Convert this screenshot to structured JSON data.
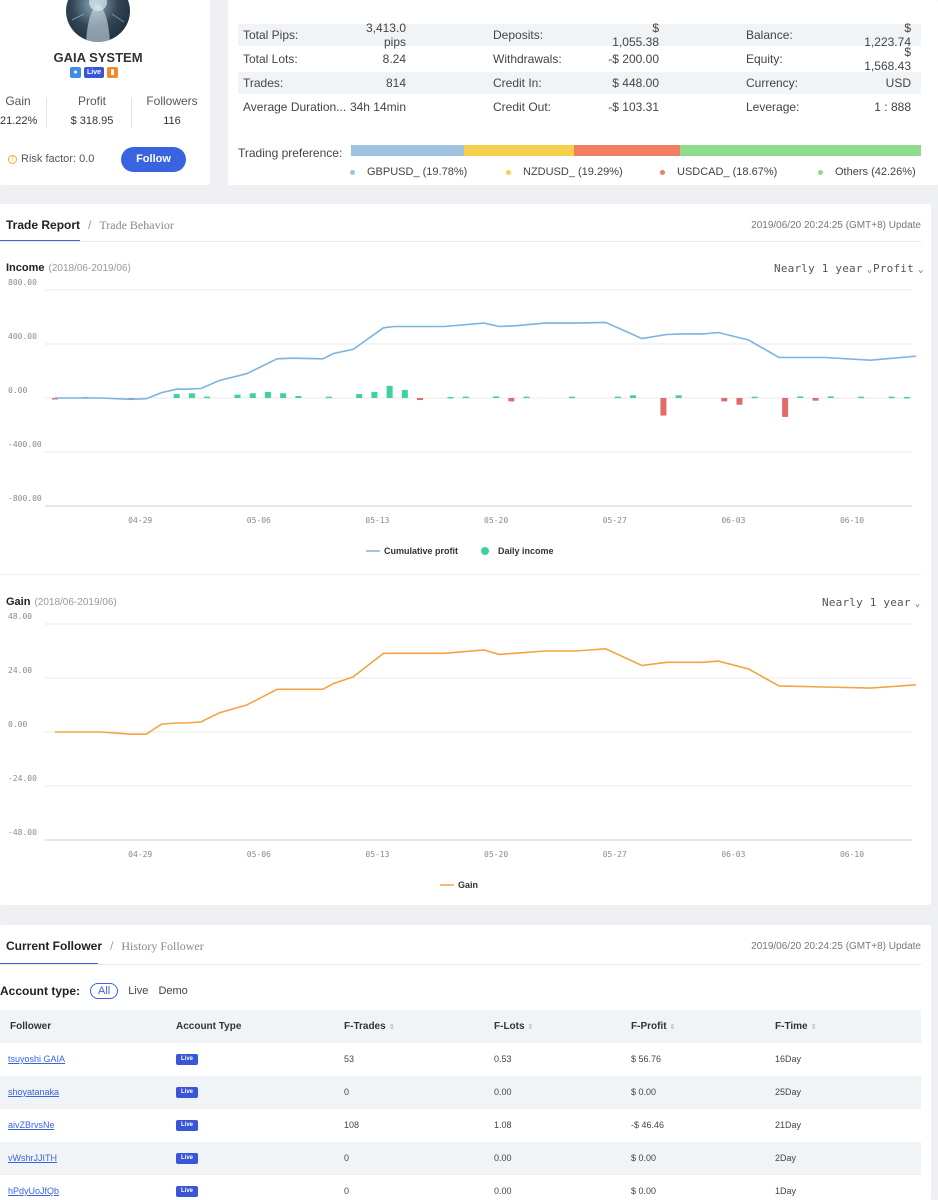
{
  "profile": {
    "name": "GAIA SYSTEM",
    "live_badge": "Live",
    "gain_label": "Gain",
    "gain_value": "21.22%",
    "profit_label": "Profit",
    "profit_value": "$ 318.95",
    "followers_label": "Followers",
    "followers_value": "116",
    "risk_text": "Risk factor: 0.0",
    "follow_button": "Follow"
  },
  "stats": {
    "rows": [
      [
        "Total Pips:",
        "3,413.0 pips",
        "Deposits:",
        "$ 1,055.38",
        "Balance:",
        "$ 1,223.74"
      ],
      [
        "Total Lots:",
        "8.24",
        "Withdrawals:",
        "-$ 200.00",
        "Equity:",
        "$ 1,568.43"
      ],
      [
        "Trades:",
        "814",
        "Credit In:",
        "$ 448.00",
        "Currency:",
        "USD"
      ],
      [
        "Average Duration...",
        "34h 14min",
        "Credit Out:",
        "-$ 103.31",
        "Leverage:",
        "1 : 888"
      ]
    ],
    "trading_preference_label": "Trading preference:",
    "preference": [
      {
        "label": "GBPUSD_ (19.78%)",
        "share": 19.78,
        "color": "#9ec3e0"
      },
      {
        "label": "NZDUSD_ (19.29%)",
        "share": 19.29,
        "color": "#f6d04d"
      },
      {
        "label": "USDCAD_ (18.67%)",
        "share": 18.67,
        "color": "#f07e61"
      },
      {
        "label": "Others (42.26%)",
        "share": 42.26,
        "color": "#8fdc8c"
      }
    ]
  },
  "report": {
    "tab_active": "Trade Report",
    "tab_sep": "/",
    "tab_inactive": "Trade Behavior",
    "timestamp": "2019/06/20 20:24:25 (GMT+8) Update",
    "income": {
      "title": "Income",
      "range": "(2018/06-2019/06)",
      "period": "Nearly 1 year",
      "metric": "Profit",
      "legend_line": "Cumulative profit",
      "legend_bar": "Daily income"
    },
    "gain": {
      "title": "Gain",
      "range": "(2018/06-2019/06)",
      "period": "Nearly 1 year",
      "legend_line": "Gain"
    }
  },
  "chart_data": [
    {
      "type": "line",
      "title": "Income",
      "ylim": [
        -800,
        800
      ],
      "yticks": [
        "800.00",
        "400.00",
        "0.00",
        "-400.00",
        "-800.00"
      ],
      "categories": [
        "04-29",
        "05-06",
        "05-13",
        "05-20",
        "05-27",
        "06-03",
        "06-10",
        "06-17"
      ],
      "series": [
        {
          "name": "Cumulative profit",
          "color": "#7cb3e0",
          "x": [
            0,
            3,
            5,
            6,
            7,
            8,
            8.6,
            9.6,
            10.8,
            12.6,
            14.6,
            15.6,
            17.6,
            18.3,
            19.6,
            21.6,
            22.3,
            23.3,
            25.6,
            28.2,
            29.2,
            30.2,
            32.2,
            33.2,
            34.2,
            36.2,
            38.6,
            40.2,
            41.2,
            42.6,
            43.6,
            45.6,
            47.6,
            50.6,
            53.6,
            55.6,
            56.6
          ],
          "values": [
            0,
            0,
            -10,
            -5,
            40,
            65,
            65,
            70,
            130,
            180,
            290,
            295,
            290,
            330,
            360,
            520,
            530,
            530,
            530,
            555,
            530,
            535,
            555,
            555,
            555,
            560,
            440,
            470,
            475,
            475,
            485,
            430,
            300,
            300,
            280,
            300,
            310
          ]
        }
      ],
      "bars": {
        "name": "Daily income",
        "positive_color": "#3dd39a",
        "negative_color": "#e36a6a",
        "x": [
          0,
          2,
          5,
          8,
          9,
          10,
          12,
          13,
          14,
          15,
          16,
          18,
          20,
          21,
          22,
          23,
          24,
          26,
          27,
          29,
          30,
          31,
          34,
          37,
          38,
          40,
          41,
          44,
          45,
          46,
          48,
          49,
          50,
          51,
          53,
          55,
          56
        ],
        "values": [
          -8,
          8,
          -10,
          30,
          35,
          10,
          25,
          35,
          45,
          35,
          15,
          10,
          30,
          45,
          90,
          60,
          -15,
          8,
          10,
          12,
          -25,
          10,
          10,
          10,
          20,
          -130,
          20,
          -25,
          -50,
          10,
          -140,
          12,
          -20,
          12,
          10,
          10,
          8
        ]
      }
    },
    {
      "type": "line",
      "title": "Gain",
      "ylim": [
        -48,
        48
      ],
      "yticks": [
        "48.00",
        "24.00",
        "0.00",
        "-24.00",
        "-48.00"
      ],
      "categories": [
        "04-29",
        "05-06",
        "05-13",
        "05-20",
        "05-27",
        "06-03",
        "06-10",
        "06-17"
      ],
      "series": [
        {
          "name": "Gain",
          "color": "#f3a442",
          "x": [
            0,
            3,
            5,
            6,
            7,
            8,
            8.6,
            9.6,
            10.8,
            12.6,
            14.6,
            15.6,
            17.6,
            18.3,
            19.6,
            21.6,
            22.3,
            23.3,
            25.6,
            28.2,
            29.2,
            30.2,
            32.2,
            33.2,
            34.2,
            36.2,
            38.6,
            40.2,
            41.2,
            42.6,
            43.6,
            45.6,
            47.6,
            50.6,
            53.6,
            55.6,
            56.6
          ],
          "values": [
            0,
            0,
            -1,
            -1,
            3.5,
            4,
            4,
            4.5,
            8.5,
            12,
            19,
            19,
            19,
            21.5,
            24.5,
            35,
            35,
            35,
            35,
            36.5,
            34.5,
            35,
            36,
            36,
            36,
            37,
            29.5,
            31,
            31,
            31,
            31.5,
            28,
            20.5,
            20,
            19.5,
            20.5,
            21
          ]
        }
      ]
    }
  ],
  "follower": {
    "tab_active": "Current Follower",
    "tab_sep": "/",
    "tab_inactive": "History Follower",
    "timestamp": "2019/06/20 20:24:25 (GMT+8) Update",
    "account_type_label": "Account type:",
    "filter_all": "All",
    "filter_live": "Live",
    "filter_demo": "Demo",
    "columns": [
      "Follower",
      "Account Type",
      "F-Trades",
      "F-Lots",
      "F-Profit",
      "F-Time"
    ],
    "rows": [
      {
        "name": "tsuyoshi GAIA",
        "type": "Live",
        "trades": "53",
        "lots": "0.53",
        "profit": "$ 56.76",
        "time": "16Day"
      },
      {
        "name": "shoyatanaka",
        "type": "Live",
        "trades": "0",
        "lots": "0.00",
        "profit": "$ 0.00",
        "time": "25Day"
      },
      {
        "name": "aivZBrvsNe",
        "type": "Live",
        "trades": "108",
        "lots": "1.08",
        "profit": "-$ 46.46",
        "time": "21Day"
      },
      {
        "name": "vWshrJJITH",
        "type": "Live",
        "trades": "0",
        "lots": "0.00",
        "profit": "$ 0.00",
        "time": "2Day"
      },
      {
        "name": "hPdyUoJfQb",
        "type": "Live",
        "trades": "0",
        "lots": "0.00",
        "profit": "$ 0.00",
        "time": "1Day"
      }
    ]
  }
}
